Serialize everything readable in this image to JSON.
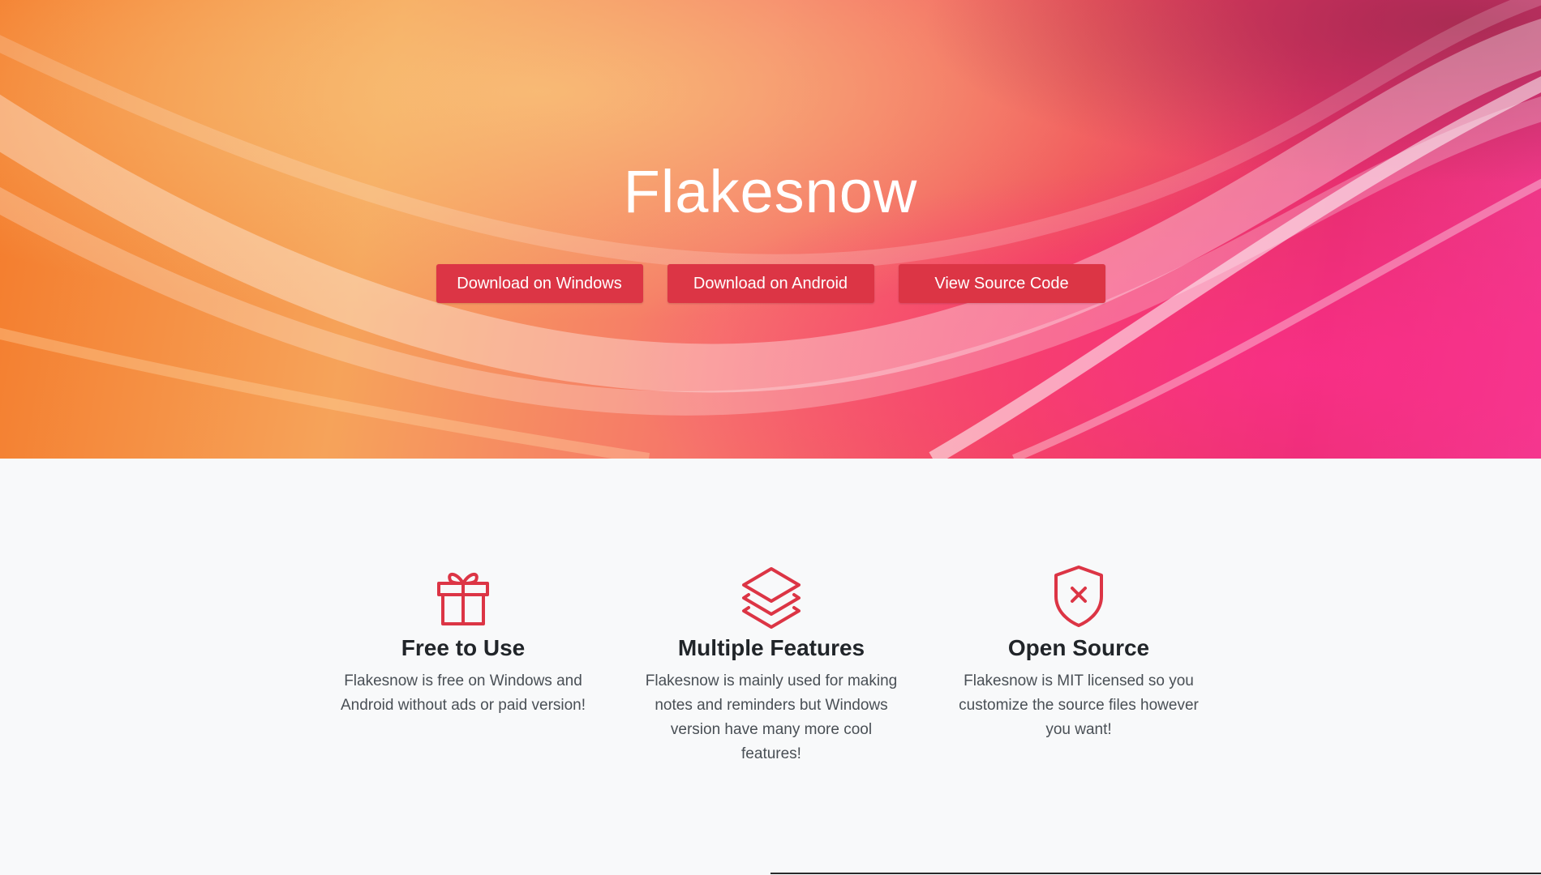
{
  "hero": {
    "title": "Flakesnow",
    "buttons": [
      {
        "label": "Download on Windows"
      },
      {
        "label": "Download on Android"
      },
      {
        "label": "View Source Code"
      }
    ]
  },
  "features": [
    {
      "icon": "gift-icon",
      "title": "Free to Use",
      "text": "Flakesnow is free on Windows and Android without ads or paid version!"
    },
    {
      "icon": "layers-icon",
      "title": "Multiple Features",
      "text": "Flakesnow is mainly used for making notes and reminders but Windows version have many more cool features!"
    },
    {
      "icon": "shield-x-icon",
      "title": "Open Source",
      "text": "Flakesnow is MIT licensed so you customize the source files however you want!"
    }
  ],
  "colors": {
    "accent": "#dc3545",
    "icon": "#dc3545",
    "background": "#f8f9fa",
    "heading": "#212529"
  }
}
